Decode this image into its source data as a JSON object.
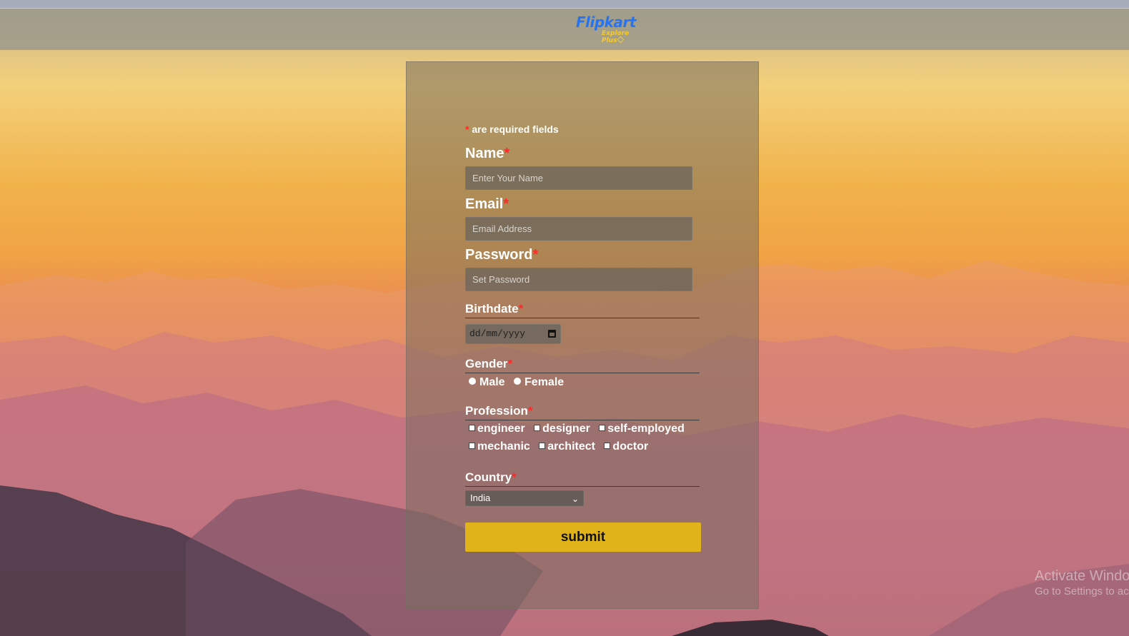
{
  "header": {
    "logo_main": "Flipkart",
    "logo_sub": "Explore Plus",
    "logo_color": "#2874f0",
    "logo_sub_color": "#f7cb2d"
  },
  "form": {
    "required_note": "are required fields",
    "required_marker": "*",
    "name": {
      "label": "Name",
      "placeholder": "Enter Your Name"
    },
    "email": {
      "label": "Email",
      "placeholder": "Email Address"
    },
    "password": {
      "label": "Password",
      "placeholder": "Set Password"
    },
    "birthdate": {
      "label": "Birthdate",
      "value": "dd/mm/yyyy"
    },
    "gender": {
      "label": "Gender",
      "options": [
        "Male",
        "Female"
      ]
    },
    "profession": {
      "label": "Profession",
      "options": [
        "engineer",
        "designer",
        "self-employed",
        "mechanic",
        "architect",
        "doctor"
      ]
    },
    "country": {
      "label": "Country",
      "selected": "India"
    },
    "submit_label": "submit",
    "submit_color": "#e1b31b"
  },
  "watermark": {
    "line1": "Activate Windo",
    "line2": "Go to Settings to ac"
  }
}
